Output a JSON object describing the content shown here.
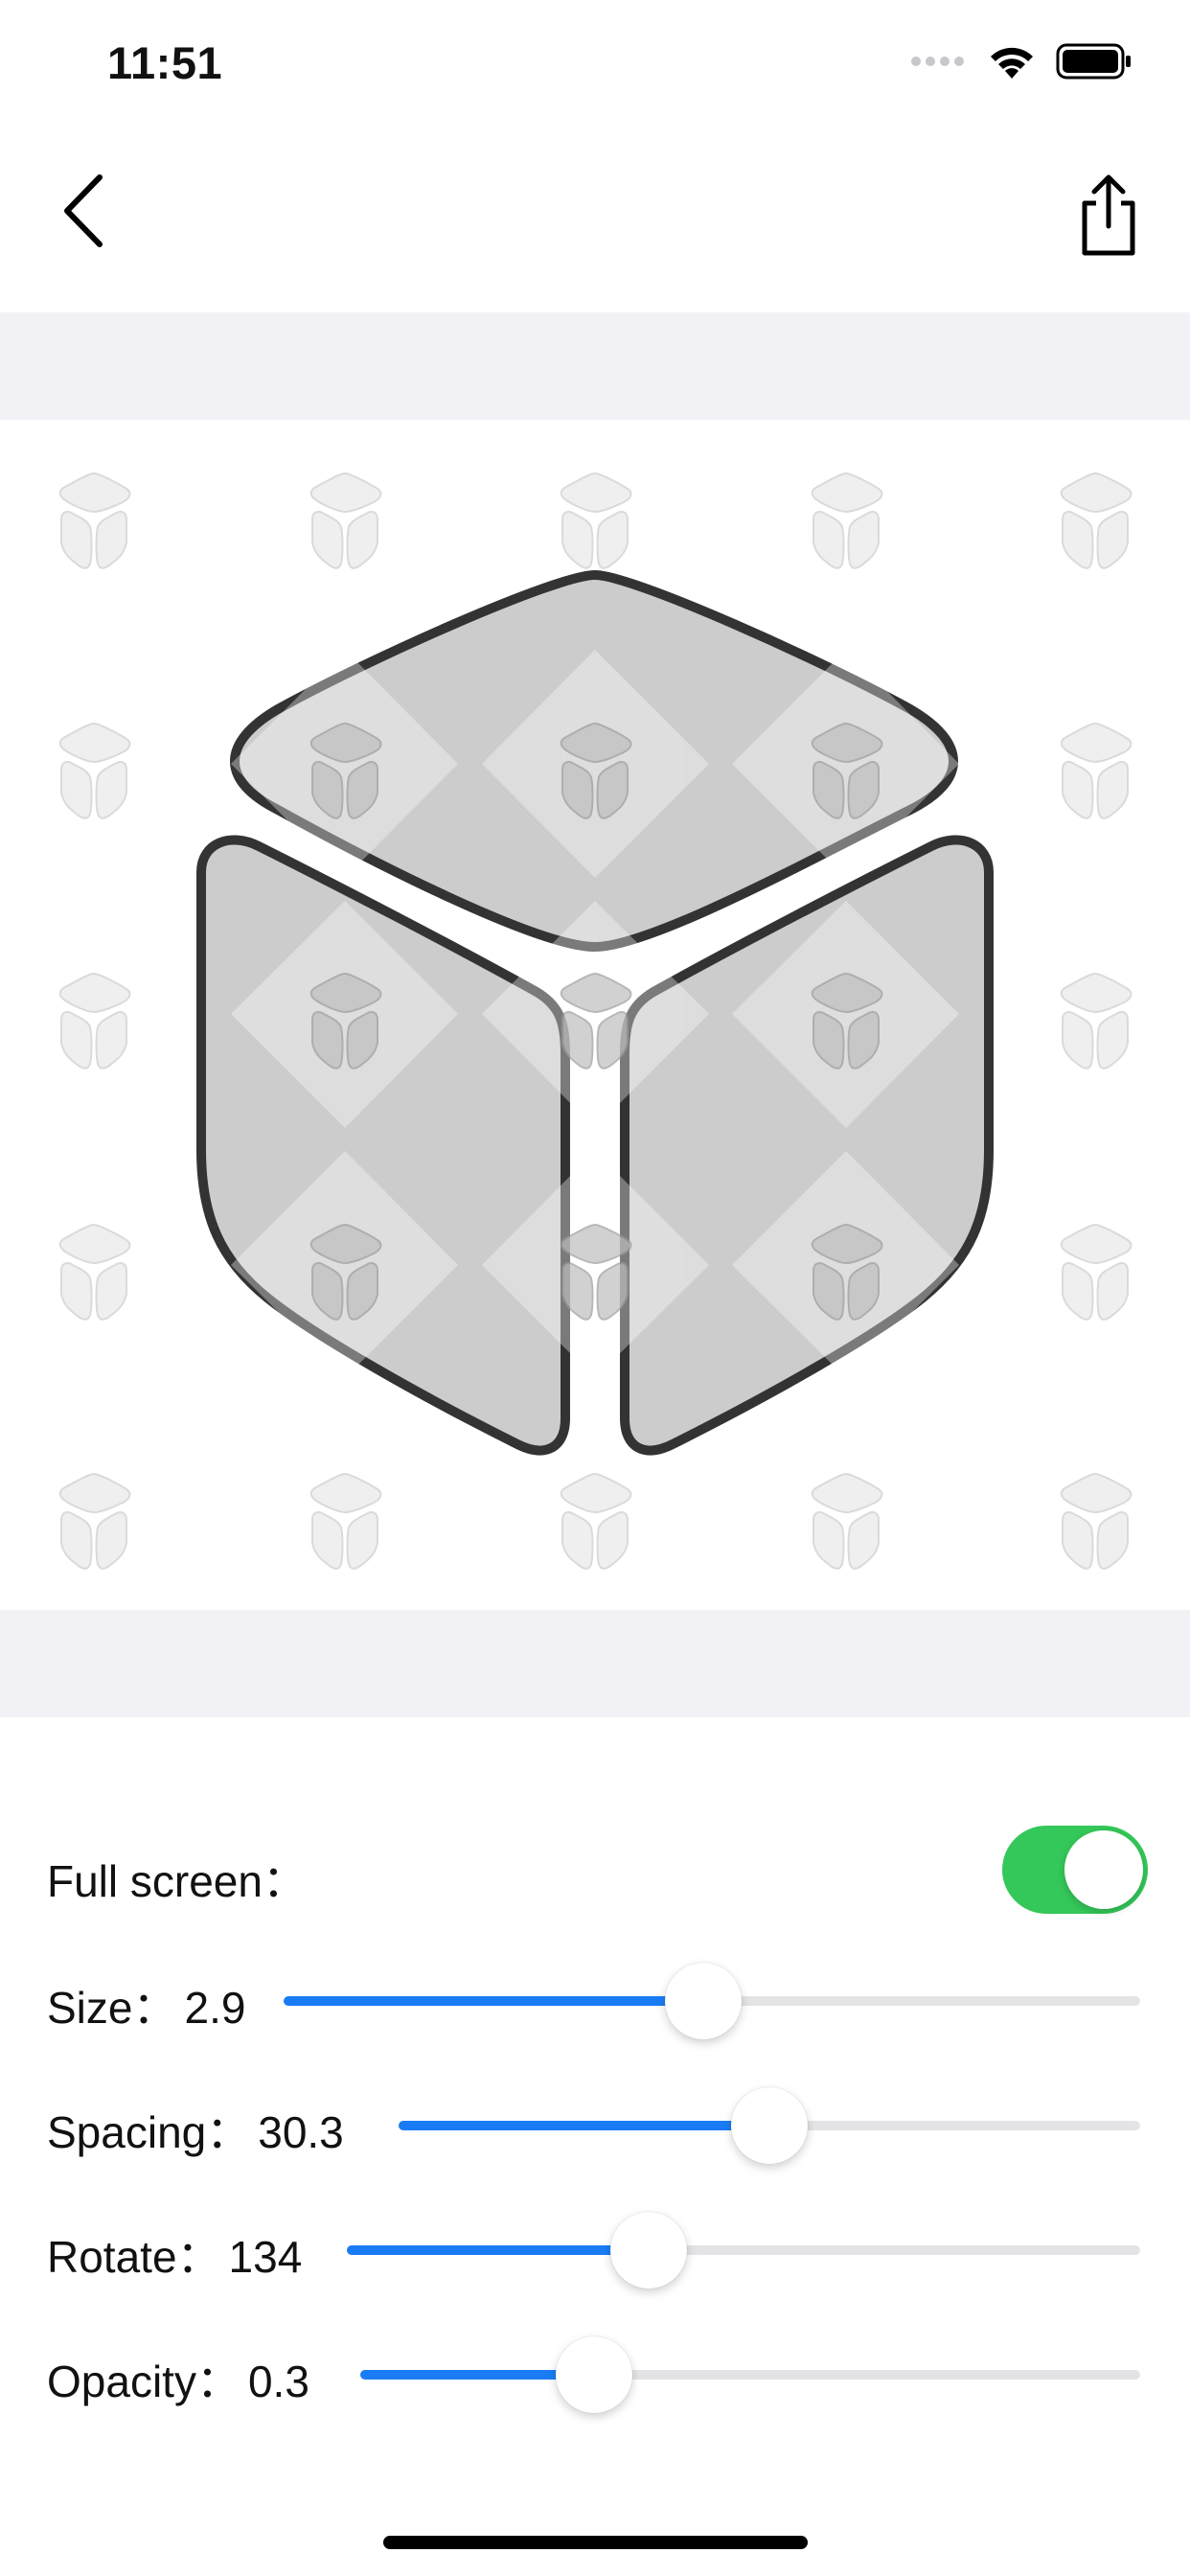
{
  "status_bar": {
    "time": "11:51",
    "icons": [
      "signal-dots-icon",
      "wifi-icon",
      "battery-icon"
    ]
  },
  "nav": {
    "back_icon": "chevron-left-icon",
    "share_icon": "share-icon"
  },
  "preview": {
    "icon": "cube-icon",
    "watermark_icon": "cube-icon",
    "watermark_opacity": 0.3
  },
  "controls": {
    "full_screen": {
      "label": "Full screen：",
      "on": true
    },
    "size": {
      "label": "Size：",
      "value": "2.9",
      "fraction": 0.49
    },
    "spacing": {
      "label": "Spacing：",
      "value": "30.3",
      "fraction": 0.5
    },
    "rotate": {
      "label": "Rotate：",
      "value": "134",
      "fraction": 0.38
    },
    "opacity": {
      "label": "Opacity：",
      "value": "0.3",
      "fraction": 0.3
    }
  },
  "colors": {
    "accent": "#1a7cf5",
    "toggle_on": "#34c759",
    "band": "#f2f2f6"
  }
}
